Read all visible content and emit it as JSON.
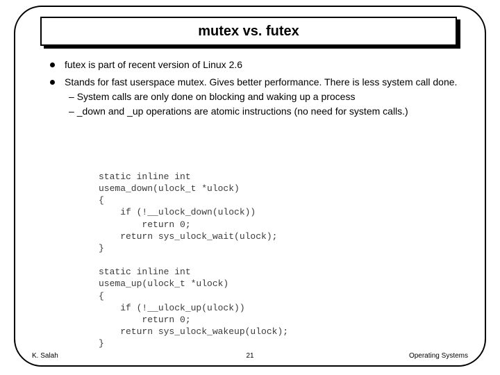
{
  "title": "mutex vs. futex",
  "bullets": [
    {
      "text": "futex is part of recent version of Linux 2.6",
      "subs": []
    },
    {
      "text": "Stands for fast userspace mutex.  Gives better performance.  There is less system call done.",
      "subs": [
        "System calls are only done on blocking and waking up a process",
        "_down and _up operations are atomic instructions (no need for system calls.)"
      ]
    }
  ],
  "code": "static inline int\nusema_down(ulock_t *ulock)\n{\n    if (!__ulock_down(ulock))\n        return 0;\n    return sys_ulock_wait(ulock);\n}\n\nstatic inline int\nusema_up(ulock_t *ulock)\n{\n    if (!__ulock_up(ulock))\n        return 0;\n    return sys_ulock_wakeup(ulock);\n}",
  "footer": {
    "left": "K. Salah",
    "center": "21",
    "right": "Operating Systems"
  }
}
